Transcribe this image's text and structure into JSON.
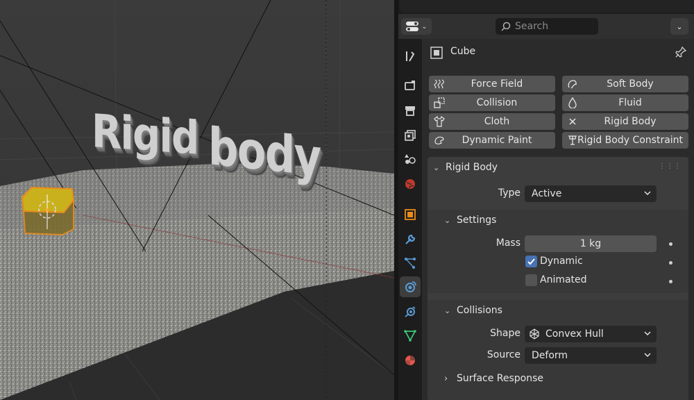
{
  "viewport": {
    "overlay_text": "Rigid body",
    "overlay_word1": "Rigid",
    "overlay_word2": "body"
  },
  "header": {
    "search_placeholder": "Search"
  },
  "context": {
    "object_name": "Cube"
  },
  "physics_buttons": {
    "force_field": "Force Field",
    "soft_body": "Soft Body",
    "collision": "Collision",
    "fluid": "Fluid",
    "cloth": "Cloth",
    "rigid_body": "Rigid Body",
    "dynamic_paint": "Dynamic Paint",
    "rigid_body_constraint": "Rigid Body Constraint"
  },
  "rigid_body_panel": {
    "title": "Rigid Body",
    "type_label": "Type",
    "type_value": "Active",
    "settings": {
      "title": "Settings",
      "mass_label": "Mass",
      "mass_value": "1 kg",
      "dynamic_label": "Dynamic",
      "dynamic_checked": true,
      "animated_label": "Animated",
      "animated_checked": false
    },
    "collisions": {
      "title": "Collisions",
      "shape_label": "Shape",
      "shape_value": "Convex Hull",
      "source_label": "Source",
      "source_value": "Deform"
    },
    "surface_response": {
      "title": "Surface Response",
      "expanded": false
    }
  },
  "colors": {
    "accent_blue": "#4772b3",
    "panel_bg": "#3d3d3d",
    "button_bg": "#545454",
    "field_bg": "#282828"
  }
}
